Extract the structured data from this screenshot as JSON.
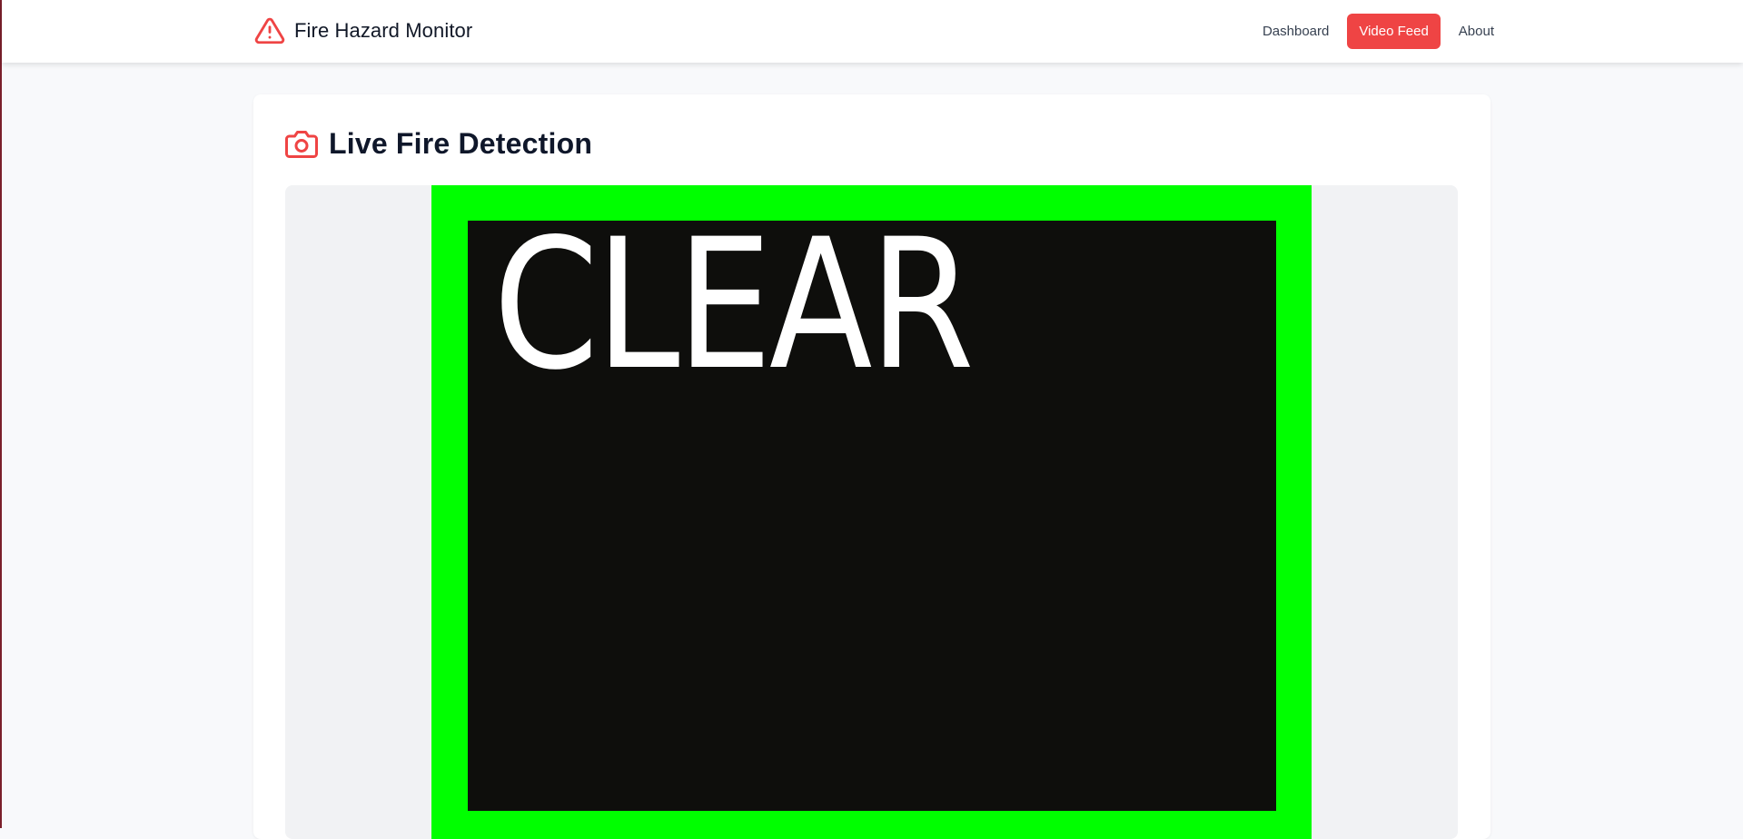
{
  "app": {
    "title": "Fire Hazard Monitor",
    "brand_icon": "warning-triangle-icon"
  },
  "nav": {
    "items": [
      {
        "label": "Dashboard",
        "active": false
      },
      {
        "label": "Video Feed",
        "active": true
      },
      {
        "label": "About",
        "active": false
      }
    ]
  },
  "main": {
    "title": "Live Fire Detection",
    "title_icon": "camera-icon",
    "video": {
      "status_label": "CLEAR",
      "frame_color": "#00ff00"
    }
  },
  "colors": {
    "accent": "#ef4444",
    "frame": "#00ff00",
    "video_bg": "#0e0e0c"
  }
}
